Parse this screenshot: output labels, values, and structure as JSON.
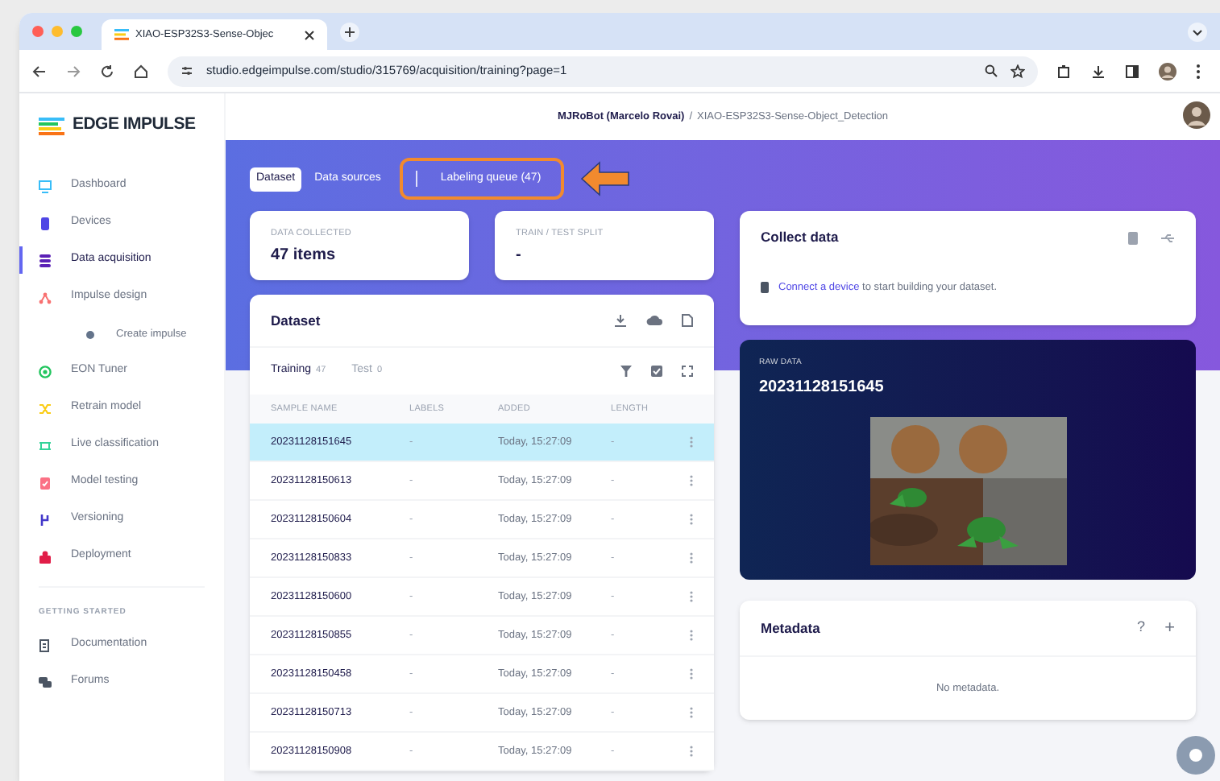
{
  "browser": {
    "tab_title": "XIAO-ESP32S3-Sense-Objec",
    "url": "studio.edgeimpulse.com/studio/315769/acquisition/training?page=1"
  },
  "logo": {
    "text": "EDGE IMPULSE"
  },
  "breadcrumb": {
    "owner": "MJRoBot (Marcelo Rovai)",
    "separator": "/",
    "project": "XIAO-ESP32S3-Sense-Object_Detection"
  },
  "sidebar": {
    "items": [
      {
        "label": "Dashboard",
        "kind": "monitor",
        "color": "#38bdf8",
        "selected": false
      },
      {
        "label": "Devices",
        "kind": "device",
        "color": "#4f46e5",
        "selected": false
      },
      {
        "label": "Data acquisition",
        "kind": "stack",
        "color": "#5b21b6",
        "selected": true
      },
      {
        "label": "Impulse design",
        "kind": "nodes",
        "color": "#f87171",
        "selected": false,
        "children": [
          {
            "label": "Create impulse",
            "kind": "dot",
            "color": "#64748b",
            "selected": false
          }
        ]
      },
      {
        "label": "EON Tuner",
        "kind": "gauge",
        "color": "#22c55e",
        "selected": false
      },
      {
        "label": "Retrain model",
        "kind": "shuffle",
        "color": "#facc15",
        "selected": false
      },
      {
        "label": "Live classification",
        "kind": "wave",
        "color": "#34d399",
        "selected": false
      },
      {
        "label": "Model testing",
        "kind": "clipboard",
        "color": "#fb7185",
        "selected": false
      },
      {
        "label": "Versioning",
        "kind": "branch",
        "color": "#4338ca",
        "selected": false
      },
      {
        "label": "Deployment",
        "kind": "box",
        "color": "#e11d48",
        "selected": false
      }
    ],
    "section_title": "GETTING STARTED",
    "help_items": [
      {
        "label": "Documentation",
        "kind": "doc"
      },
      {
        "label": "Forums",
        "kind": "chat"
      }
    ]
  },
  "tabs": [
    {
      "label": "Dataset",
      "selected": true
    },
    {
      "label": "Data sources",
      "selected": false
    },
    {
      "label": "Labeling queue (47)",
      "selected": false,
      "highlighted": true
    }
  ],
  "stats": [
    {
      "label": "DATA COLLECTED",
      "value": "47 items"
    },
    {
      "label": "TRAIN / TEST SPLIT",
      "value": "-"
    }
  ],
  "dataset": {
    "title": "Dataset",
    "subtabs": [
      {
        "label": "Training",
        "count": "47",
        "selected": true
      },
      {
        "label": "Test",
        "count": "0",
        "selected": false
      }
    ],
    "columns": [
      "SAMPLE NAME",
      "LABELS",
      "ADDED",
      "LENGTH"
    ],
    "rows": [
      {
        "name": "20231128151645",
        "labels": "-",
        "added": "Today, 15:27:09",
        "length": "-",
        "selected": true
      },
      {
        "name": "20231128150613",
        "labels": "-",
        "added": "Today, 15:27:09",
        "length": "-",
        "selected": false
      },
      {
        "name": "20231128150604",
        "labels": "-",
        "added": "Today, 15:27:09",
        "length": "-",
        "selected": false
      },
      {
        "name": "20231128150833",
        "labels": "-",
        "added": "Today, 15:27:09",
        "length": "-",
        "selected": false
      },
      {
        "name": "20231128150600",
        "labels": "-",
        "added": "Today, 15:27:09",
        "length": "-",
        "selected": false
      },
      {
        "name": "20231128150855",
        "labels": "-",
        "added": "Today, 15:27:09",
        "length": "-",
        "selected": false
      },
      {
        "name": "20231128150458",
        "labels": "-",
        "added": "Today, 15:27:09",
        "length": "-",
        "selected": false
      },
      {
        "name": "20231128150713",
        "labels": "-",
        "added": "Today, 15:27:09",
        "length": "-",
        "selected": false
      },
      {
        "name": "20231128150908",
        "labels": "-",
        "added": "Today, 15:27:09",
        "length": "-",
        "selected": false
      }
    ]
  },
  "collect": {
    "title": "Collect data",
    "link": "Connect a device",
    "text": " to start building your dataset."
  },
  "raw_data": {
    "label": "RAW DATA",
    "name": "20231128151645"
  },
  "metadata": {
    "title": "Metadata",
    "help": "?",
    "add": "+",
    "empty": "No metadata."
  }
}
